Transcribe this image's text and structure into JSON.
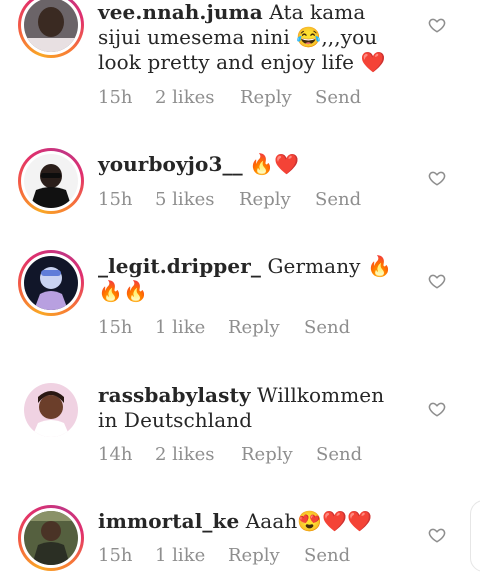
{
  "comments": [
    {
      "username": "vee.nnah.juma",
      "text": "Ata kama sijui umesema nini 😂,,,you look pretty and enjoy life ❤️",
      "time": "15h",
      "likes": "2 likes",
      "reply": "Reply",
      "send": "Send"
    },
    {
      "username": "yourboyjo3__",
      "text": "🔥❤️",
      "time": "15h",
      "likes": "5 likes",
      "reply": "Reply",
      "send": "Send"
    },
    {
      "username": "_legit.dripper_",
      "text": "Germany 🔥🔥🔥",
      "time": "15h",
      "likes": "1 like",
      "reply": "Reply",
      "send": "Send"
    },
    {
      "username": "rassbabylasty",
      "text": "Willkommen in Deutschland",
      "time": "14h",
      "likes": "2 likes",
      "reply": "Reply",
      "send": "Send"
    },
    {
      "username": "immortal_ke",
      "text": "Aaah😍❤️❤️",
      "time": "15h",
      "likes": "1 like",
      "reply": "Reply",
      "send": "Send"
    }
  ],
  "icons": {
    "like": "heart-outline-icon"
  },
  "colors": {
    "text": "#262626",
    "meta": "#8e8e8e",
    "heart_red": "#e0162b"
  }
}
